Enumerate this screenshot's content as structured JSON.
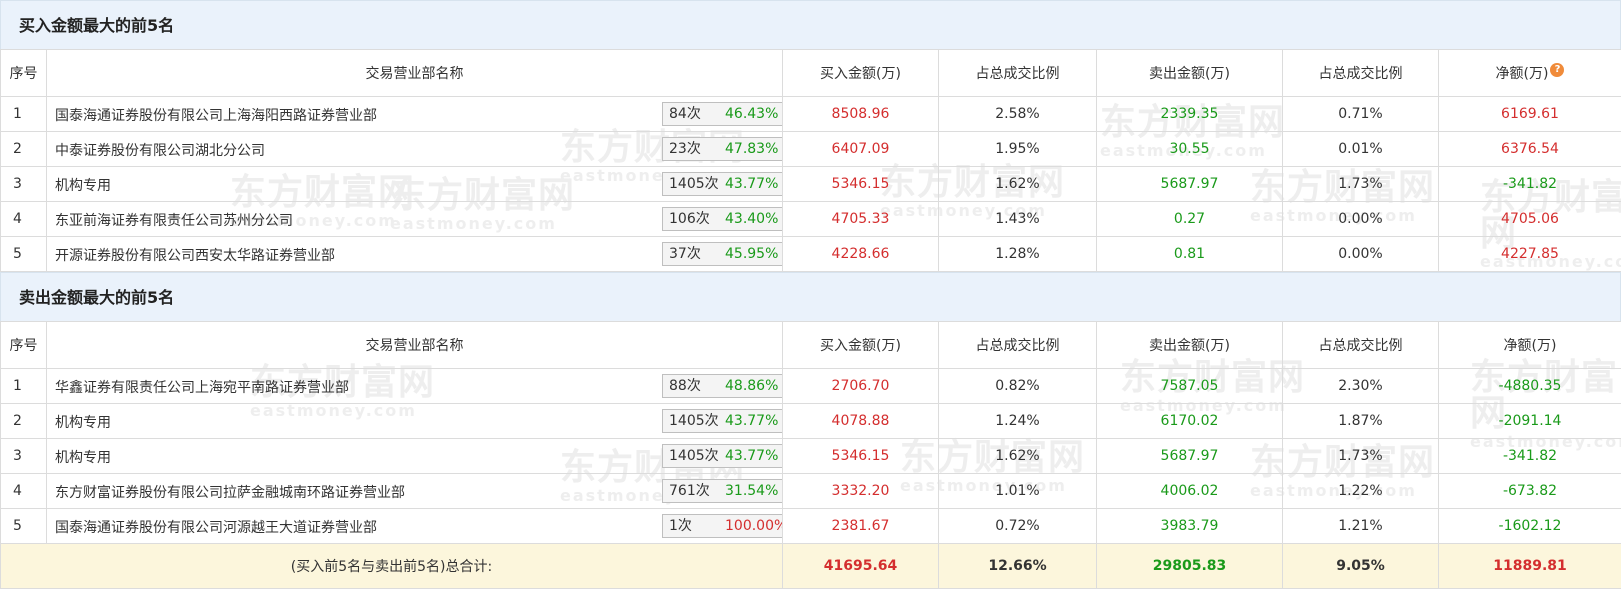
{
  "icons": {
    "help": "question-circle-icon",
    "expand": "play-arrow-icon"
  },
  "colors": {
    "up": "#d42e2e",
    "down": "#1a9a1a",
    "header_bg": "#eaf2fb",
    "total_bg": "#fcf6dc",
    "help_icon": "#f08b3a"
  },
  "watermark": {
    "cn": "东方财富网",
    "en": "eastmoney.com"
  },
  "columns": [
    "序号",
    "交易营业部名称",
    "买入金额(万)",
    "占总成交比例",
    "卖出金额(万)",
    "占总成交比例",
    "净额(万)"
  ],
  "buy": {
    "title": "买入金额最大的前5名",
    "rows": [
      {
        "idx": "1",
        "name": "国泰海通证券股份有限公司上海海阳西路证券营业部",
        "count": "84次",
        "pct": "46.43%",
        "pct_color": "green",
        "icon": "help",
        "buy": "8508.96",
        "buy_ratio": "2.58%",
        "sell": "2339.35",
        "sell_ratio": "0.71%",
        "net": "6169.61",
        "net_color": "red"
      },
      {
        "idx": "2",
        "name": "中泰证券股份有限公司湖北分公司",
        "count": "23次",
        "pct": "47.83%",
        "pct_color": "green",
        "icon": "expand",
        "buy": "6407.09",
        "buy_ratio": "1.95%",
        "sell": "30.55",
        "sell_ratio": "0.01%",
        "net": "6376.54",
        "net_color": "red"
      },
      {
        "idx": "3",
        "name": "机构专用",
        "count": "1405次",
        "pct": "43.77%",
        "pct_color": "green",
        "icon": "expand",
        "buy": "5346.15",
        "buy_ratio": "1.62%",
        "sell": "5687.97",
        "sell_ratio": "1.73%",
        "net": "-341.82",
        "net_color": "green"
      },
      {
        "idx": "4",
        "name": "东亚前海证券有限责任公司苏州分公司",
        "count": "106次",
        "pct": "43.40%",
        "pct_color": "green",
        "icon": "expand",
        "buy": "4705.33",
        "buy_ratio": "1.43%",
        "sell": "0.27",
        "sell_ratio": "0.00%",
        "net": "4705.06",
        "net_color": "red"
      },
      {
        "idx": "5",
        "name": "开源证券股份有限公司西安太华路证券营业部",
        "count": "37次",
        "pct": "45.95%",
        "pct_color": "green",
        "icon": "expand",
        "buy": "4228.66",
        "buy_ratio": "1.28%",
        "sell": "0.81",
        "sell_ratio": "0.00%",
        "net": "4227.85",
        "net_color": "red"
      }
    ]
  },
  "sell": {
    "title": "卖出金额最大的前5名",
    "rows": [
      {
        "idx": "1",
        "name": "华鑫证券有限责任公司上海宛平南路证券营业部",
        "count": "88次",
        "pct": "48.86%",
        "pct_color": "green",
        "icon": "help",
        "buy": "2706.70",
        "buy_ratio": "0.82%",
        "sell": "7587.05",
        "sell_ratio": "2.30%",
        "net": "-4880.35",
        "net_color": "green"
      },
      {
        "idx": "2",
        "name": "机构专用",
        "count": "1405次",
        "pct": "43.77%",
        "pct_color": "green",
        "icon": "expand",
        "buy": "4078.88",
        "buy_ratio": "1.24%",
        "sell": "6170.02",
        "sell_ratio": "1.87%",
        "net": "-2091.14",
        "net_color": "green"
      },
      {
        "idx": "3",
        "name": "机构专用",
        "count": "1405次",
        "pct": "43.77%",
        "pct_color": "green",
        "icon": "expand",
        "buy": "5346.15",
        "buy_ratio": "1.62%",
        "sell": "5687.97",
        "sell_ratio": "1.73%",
        "net": "-341.82",
        "net_color": "green"
      },
      {
        "idx": "4",
        "name": "东方财富证券股份有限公司拉萨金融城南环路证券营业部",
        "count": "761次",
        "pct": "31.54%",
        "pct_color": "green",
        "icon": "expand",
        "buy": "3332.20",
        "buy_ratio": "1.01%",
        "sell": "4006.02",
        "sell_ratio": "1.22%",
        "net": "-673.82",
        "net_color": "green"
      },
      {
        "idx": "5",
        "name": "国泰海通证券股份有限公司河源越王大道证券营业部",
        "count": "1次",
        "pct": "100.00%",
        "pct_color": "red",
        "icon": "expand",
        "buy": "2381.67",
        "buy_ratio": "0.72%",
        "sell": "3983.79",
        "sell_ratio": "1.21%",
        "net": "-1602.12",
        "net_color": "green"
      }
    ]
  },
  "total": {
    "label": "(买入前5名与卖出前5名)总合计:",
    "buy": "41695.64",
    "buy_ratio": "12.66%",
    "sell": "29805.83",
    "sell_ratio": "9.05%",
    "net": "11889.81"
  }
}
